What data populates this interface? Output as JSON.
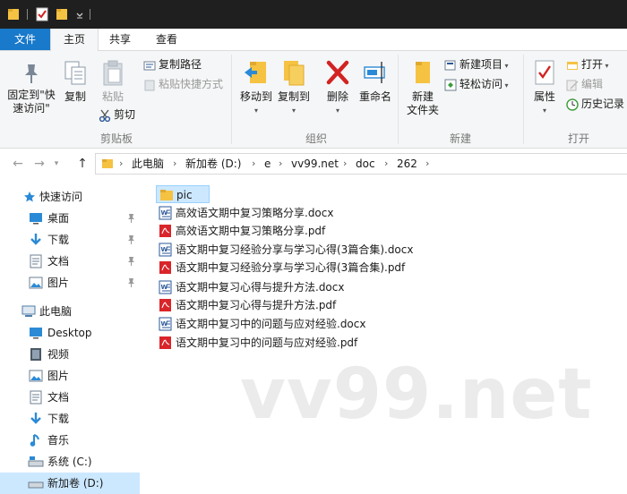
{
  "titlebar": {
    "quick_access_icons": [
      "folder-icon",
      "properties-check-icon",
      "new-folder-icon",
      "customize-dropdown-icon"
    ]
  },
  "menu": {
    "file": "文件",
    "home": "主页",
    "share": "共享",
    "view": "查看"
  },
  "ribbon": {
    "clipboard": {
      "pin_line1": "固定到\"快",
      "pin_line2": "速访问\"",
      "copy": "复制",
      "paste": "粘贴",
      "copy_path": "复制路径",
      "paste_shortcut": "粘贴快捷方式",
      "cut": "剪切",
      "group_label": "剪贴板"
    },
    "organize": {
      "move_to": "移动到",
      "copy_to": "复制到",
      "delete": "删除",
      "rename": "重命名",
      "group_label": "组织"
    },
    "new": {
      "new_folder_line1": "新建",
      "new_folder_line2": "文件夹",
      "new_item": "新建项目",
      "easy_access": "轻松访问",
      "group_label": "新建"
    },
    "open": {
      "properties": "属性",
      "open": "打开",
      "edit": "编辑",
      "history": "历史记录",
      "group_label": "打开"
    }
  },
  "address": {
    "back_icon": "back-arrow-icon",
    "forward_icon": "forward-arrow-icon",
    "recent_icon": "recent-dropdown-icon",
    "up_icon": "up-arrow-icon",
    "crumbs": [
      "此电脑",
      "新加卷 (D:)",
      "e",
      "vv99.net",
      "doc",
      "262"
    ]
  },
  "nav": {
    "quick_access": "快速访问",
    "desktop": "桌面",
    "downloads": "下载",
    "documents": "文档",
    "pictures": "图片",
    "this_pc": "此电脑",
    "desktop_en": "Desktop",
    "videos": "视频",
    "pictures2": "图片",
    "documents2": "文档",
    "downloads2": "下载",
    "music": "音乐",
    "system_c": "系统 (C:)",
    "new_volume_d": "新加卷 (D:)"
  },
  "files": [
    {
      "name": "pic",
      "type": "folder"
    },
    {
      "name": "高效语文期中复习策略分享.docx",
      "type": "docx"
    },
    {
      "name": "高效语文期中复习策略分享.pdf",
      "type": "pdf"
    },
    {
      "name": "语文期中复习经验分享与学习心得(3篇合集).docx",
      "type": "docx"
    },
    {
      "name": "语文期中复习经验分享与学习心得(3篇合集).pdf",
      "type": "pdf"
    },
    {
      "name": "语文期中复习心得与提升方法.docx",
      "type": "docx"
    },
    {
      "name": "语文期中复习心得与提升方法.pdf",
      "type": "pdf"
    },
    {
      "name": "语文期中复习中的问题与应对经验.docx",
      "type": "docx"
    },
    {
      "name": "语文期中复习中的问题与应对经验.pdf",
      "type": "pdf"
    }
  ],
  "watermark": "vv99.net",
  "colors": {
    "file_tab": "#1979ca",
    "selection": "#cce8ff",
    "folder": "#f5c242",
    "pdf": "#d9252a",
    "docx": "#2b579a",
    "delete_red": "#d22222"
  }
}
